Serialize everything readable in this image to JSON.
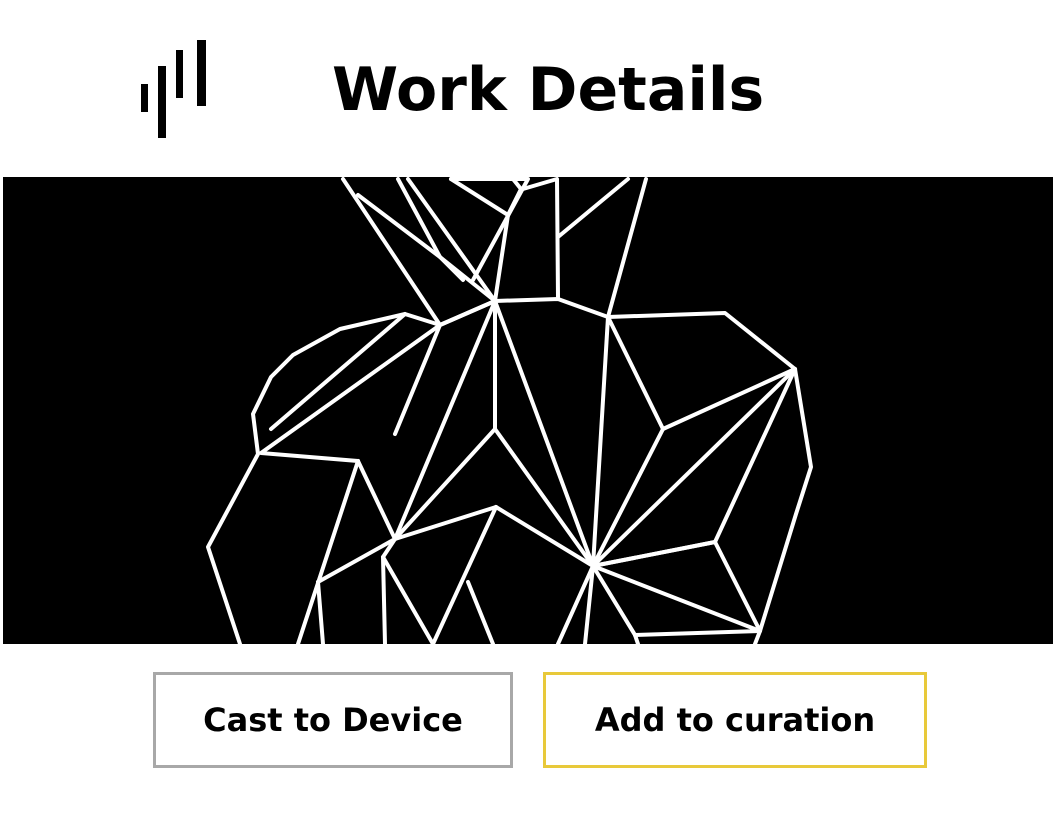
{
  "header": {
    "title": "Work Details",
    "logo_icon": "bars-logo-icon"
  },
  "artwork": {
    "description_icon": "geometric-line-art",
    "background_color": "#000000",
    "line_color": "#ffffff"
  },
  "actions": {
    "cast_label": "Cast to Device",
    "curate_label": "Add to curation",
    "cast_border_color": "#a8a8a8",
    "curate_border_color": "#e8c93a"
  }
}
